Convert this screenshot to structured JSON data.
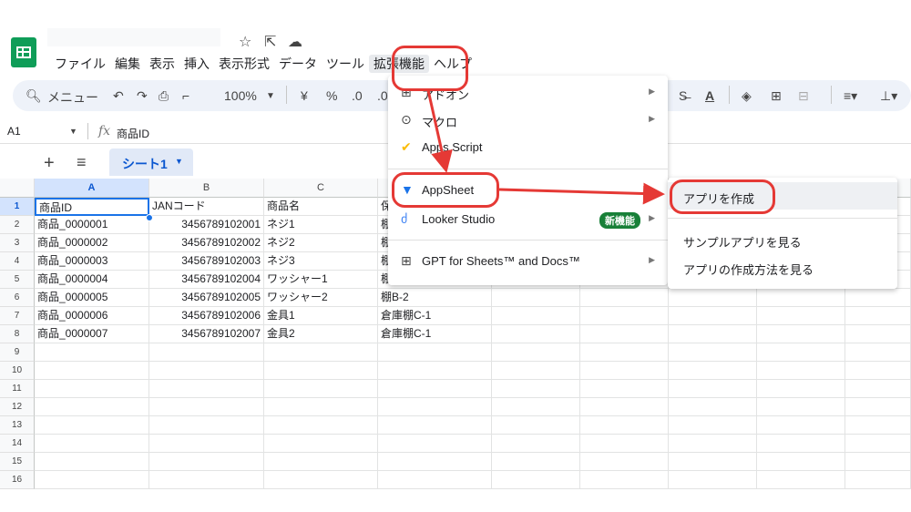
{
  "menubar": [
    "ファイル",
    "編集",
    "表示",
    "挿入",
    "表示形式",
    "データ",
    "ツール",
    "拡張機能",
    "ヘルプ"
  ],
  "toolbar": {
    "search_label": "メニュー",
    "zoom": "100%",
    "currency": "¥",
    "percent": "%",
    "decimal_less": ".0",
    "decimal_more": ".0"
  },
  "formula_bar": {
    "cell_ref": "A1",
    "fx": "fx",
    "value": "商品ID"
  },
  "sheet_tab": {
    "name": "シート1"
  },
  "columns": [
    "A",
    "B",
    "C",
    ""
  ],
  "rows": [
    "1",
    "2",
    "3",
    "4",
    "5",
    "6",
    "7",
    "8",
    "9",
    "10",
    "11",
    "12",
    "13",
    "14",
    "15",
    "16"
  ],
  "table": {
    "header": [
      "商品ID",
      "JANコード",
      "商品名",
      "保"
    ],
    "data": [
      [
        "商品_0000001",
        "3456789102001",
        "ネジ1",
        "棚"
      ],
      [
        "商品_0000002",
        "3456789102002",
        "ネジ2",
        "棚"
      ],
      [
        "商品_0000003",
        "3456789102003",
        "ネジ3",
        "棚"
      ],
      [
        "商品_0000004",
        "3456789102004",
        "ワッシャー1",
        "棚B-1"
      ],
      [
        "商品_0000005",
        "3456789102005",
        "ワッシャー2",
        "棚B-2"
      ],
      [
        "商品_0000006",
        "3456789102006",
        "金具1",
        "倉庫棚C-1"
      ],
      [
        "商品_0000007",
        "3456789102007",
        "金具2",
        "倉庫棚C-1"
      ]
    ]
  },
  "ext_menu": {
    "items": [
      {
        "label": "アドオン",
        "icon": "addon-icon",
        "submenu": true
      },
      {
        "label": "マクロ",
        "icon": "macro-icon",
        "submenu": true
      },
      {
        "label": "Apps Script",
        "icon": "apps-script-icon",
        "submenu": false
      },
      {
        "label": "AppSheet",
        "icon": "appsheet-icon",
        "submenu": true
      },
      {
        "label": "Looker Studio",
        "icon": "looker-studio-icon",
        "submenu": true,
        "badge": "新機能"
      },
      {
        "label": "GPT for Sheets™ and Docs™",
        "icon": "gpt-addon-icon",
        "submenu": true
      }
    ]
  },
  "appsheet_submenu": [
    "アプリを作成",
    "サンプルアプリを見る",
    "アプリの作成方法を見る"
  ],
  "colors": {
    "sheets_green": "#0f9d58",
    "selection_blue": "#1a73e8",
    "annotation_red": "#e53935",
    "badge_green": "#188038"
  }
}
